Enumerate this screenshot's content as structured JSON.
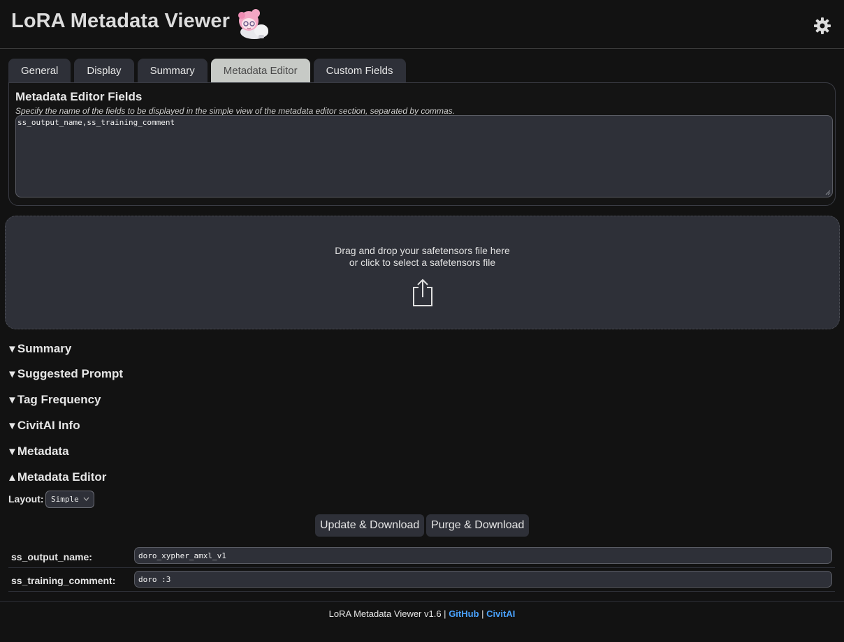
{
  "header": {
    "title": "LoRA Metadata Viewer",
    "mascot_icon": "mascot-icon",
    "settings_icon": "gear-icon"
  },
  "tabs": [
    {
      "label": "General",
      "active": false
    },
    {
      "label": "Display",
      "active": false
    },
    {
      "label": "Summary",
      "active": false
    },
    {
      "label": "Metadata Editor",
      "active": true
    },
    {
      "label": "Custom Fields",
      "active": false
    }
  ],
  "settings_panel": {
    "title": "Metadata Editor Fields",
    "description": "Specify the name of the fields to be displayed in the simple view of the metadata editor section, separated by commas.",
    "value": "ss_output_name,ss_training_comment"
  },
  "dropzone": {
    "line1": "Drag and drop your safetensors file here",
    "line2": "or click to select a safetensors file",
    "icon": "upload-icon"
  },
  "sections": [
    {
      "label": "Summary",
      "arrow": "▼"
    },
    {
      "label": "Suggested Prompt",
      "arrow": "▼"
    },
    {
      "label": "Tag Frequency",
      "arrow": "▼"
    },
    {
      "label": "CivitAI Info",
      "arrow": "▼"
    },
    {
      "label": "Metadata",
      "arrow": "▼"
    },
    {
      "label": "Metadata Editor",
      "arrow": "▲"
    }
  ],
  "editor": {
    "layout_label": "Layout:",
    "layout_value": "Simple",
    "update_button": "Update & Download",
    "purge_button": "Purge & Download",
    "fields": [
      {
        "label": "ss_output_name:",
        "value": "doro_xypher_amxl_v1"
      },
      {
        "label": "ss_training_comment:",
        "value": "doro :3"
      }
    ]
  },
  "footer": {
    "text": "LoRA Metadata Viewer v1.6 |",
    "separator": "|",
    "github": "GitHub",
    "civitai": "CivitAI"
  },
  "colors": {
    "background": "#121212",
    "panel": "#2e3038",
    "active_tab": "#c7cac6",
    "link": "#4aa3ff"
  }
}
